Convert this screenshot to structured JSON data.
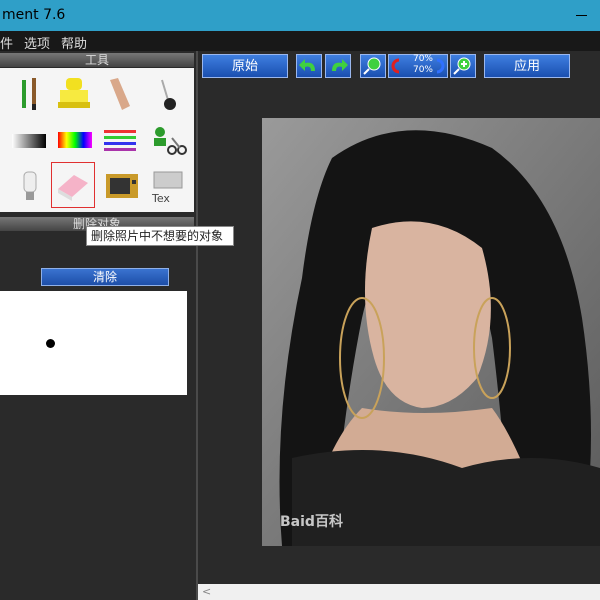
{
  "window": {
    "title": "ment 7.6"
  },
  "menu": {
    "items": [
      "件",
      "选项",
      "帮助"
    ]
  },
  "left_panel": {
    "tools_header": "工具",
    "section_header": "删除对象",
    "clear_button": "清除",
    "tooltip": "删除照片中不想要的对象"
  },
  "toolbar": {
    "original_button": "原始",
    "apply_button": "应用",
    "zoom_top": "70%",
    "zoom_bottom": "70%"
  },
  "photo": {
    "watermark": "Baid百科"
  },
  "colors": {
    "titlebar": "#2f9fc8",
    "button_blue": "#2a62c8",
    "background": "#2a2a2a"
  }
}
